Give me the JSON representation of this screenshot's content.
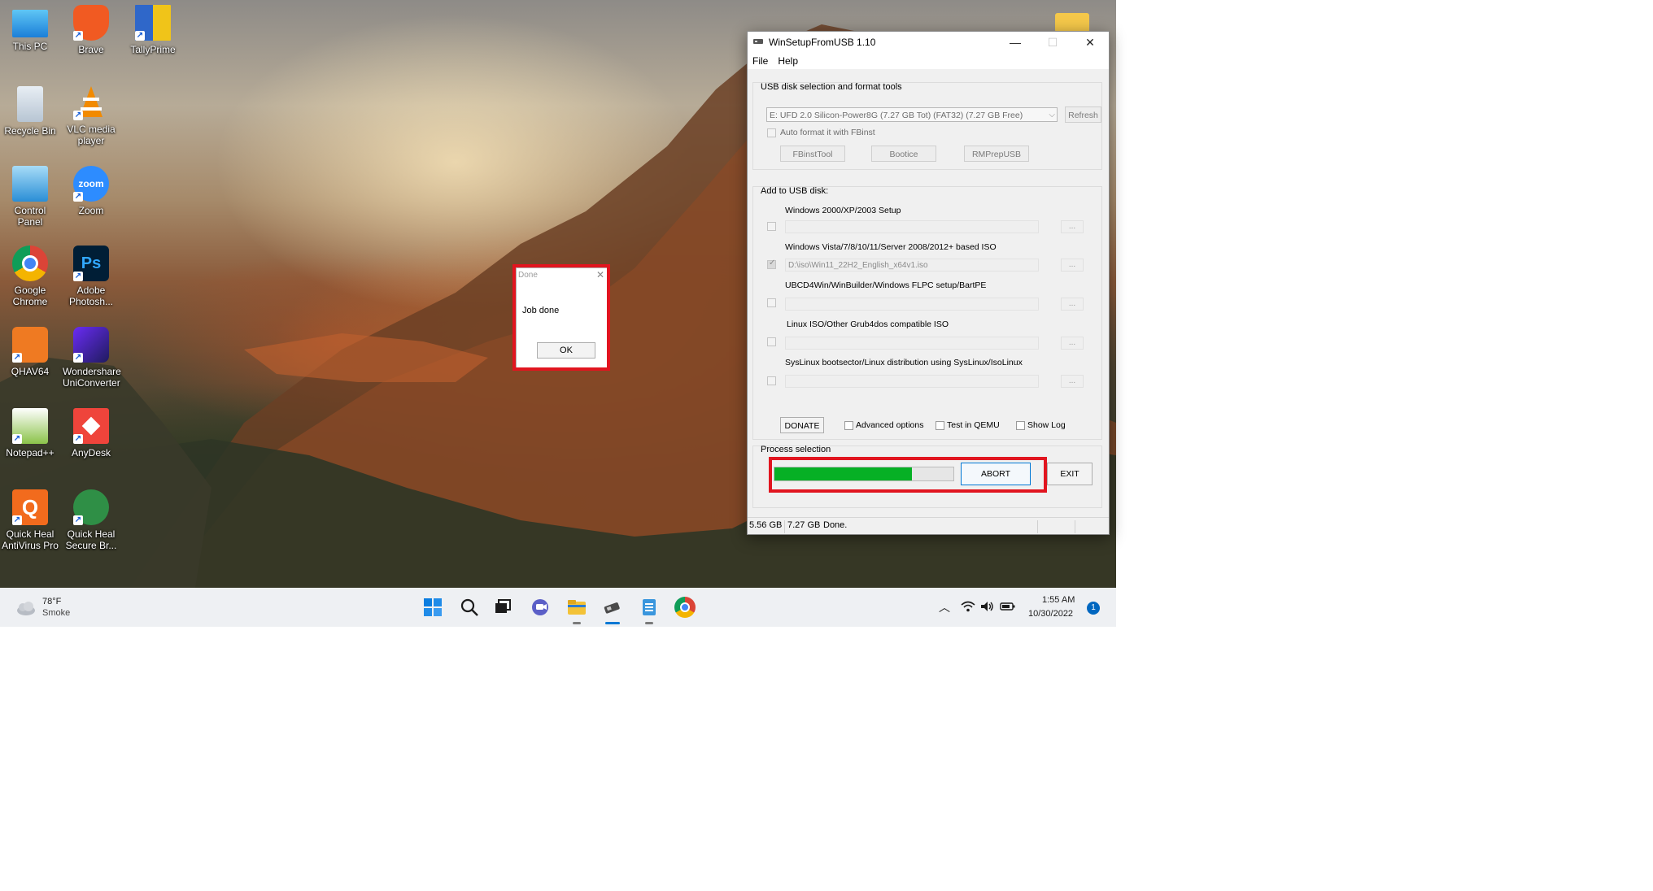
{
  "desktop": {
    "icons": [
      {
        "label": "This PC"
      },
      {
        "label": "Brave"
      },
      {
        "label": "TallyPrime"
      },
      {
        "label": "Recycle Bin"
      },
      {
        "label": "VLC media player"
      },
      {
        "label": "Control Panel"
      },
      {
        "label": "Zoom"
      },
      {
        "label": "Google Chrome"
      },
      {
        "label": "Adobe Photosh..."
      },
      {
        "label": "QHAV64"
      },
      {
        "label": "Wondershare UniConverter"
      },
      {
        "label": "Notepad++"
      },
      {
        "label": "AnyDesk"
      },
      {
        "label": "Quick Heal AntiVirus Pro"
      },
      {
        "label": "Quick Heal Secure Br..."
      }
    ],
    "zoom_icon_text": "zoom",
    "ps_icon_text": "Ps"
  },
  "window": {
    "title": "WinSetupFromUSB 1.10",
    "menu": [
      "File",
      "Help"
    ],
    "usb_group_title": "USB disk selection and format tools",
    "usb_disk": "E: UFD 2.0 Silicon-Power8G (7.27 GB Tot) (FAT32) (7.27 GB Free)",
    "refresh_label": "Refresh",
    "auto_format_label": "Auto format it with FBinst",
    "tools": [
      "FBinstTool",
      "Bootice",
      "RMPrepUSB"
    ],
    "add_group_title": "Add to USB disk:",
    "sources": [
      {
        "label": "Windows 2000/XP/2003 Setup",
        "path": "",
        "checked": false
      },
      {
        "label": "Windows Vista/7/8/10/11/Server 2008/2012+ based ISO",
        "path": "D:\\iso\\Win11_22H2_English_x64v1.iso",
        "checked": true
      },
      {
        "label": "UBCD4Win/WinBuilder/Windows FLPC setup/BartPE",
        "path": "",
        "checked": false
      },
      {
        "label": "Linux ISO/Other Grub4dos compatible ISO",
        "path": "",
        "checked": false
      },
      {
        "label": "SysLinux bootsector/Linux distribution using SysLinux/IsoLinux",
        "path": "",
        "checked": false
      }
    ],
    "browse_label": "...",
    "donate_label": "DONATE",
    "options": [
      "Advanced options",
      "Test in QEMU",
      "Show Log"
    ],
    "process_label": "Process selection",
    "progress_fraction": 0.77,
    "abort_label": "ABORT",
    "exit_label": "EXIT",
    "status": {
      "size1": "5.56 GB",
      "size2": "7.27 GB",
      "text": "Done."
    }
  },
  "dialog": {
    "title": "Done",
    "message": "Job done",
    "ok_label": "OK"
  },
  "taskbar": {
    "weather_temp": "78°F",
    "weather_desc": "Smoke",
    "time": "1:55 AM",
    "date": "10/30/2022",
    "notification_count": "1"
  },
  "colors": {
    "highlight_red": "#e1151f",
    "progress_green": "#06b025",
    "accent_blue": "#0078d4"
  }
}
